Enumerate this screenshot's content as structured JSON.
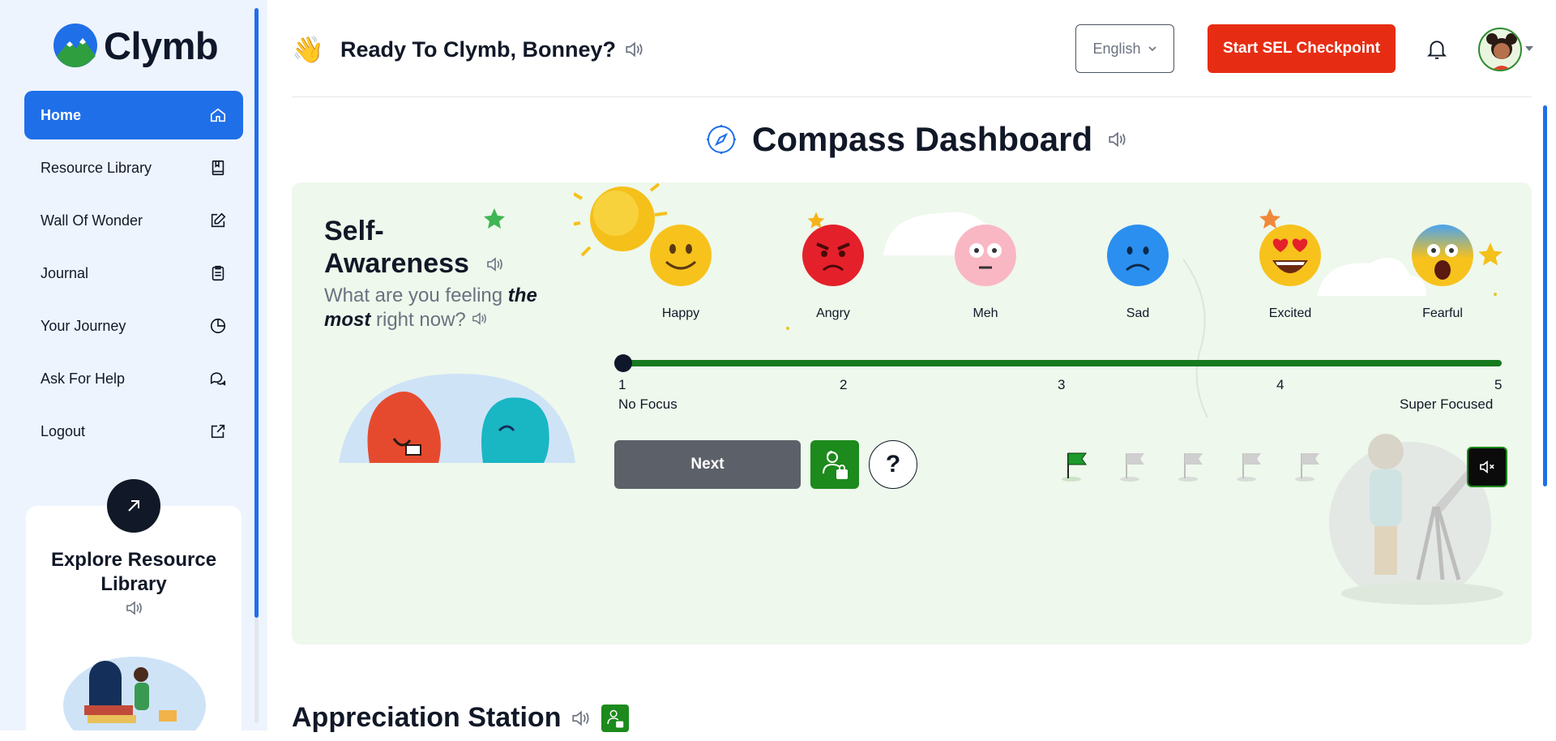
{
  "brand": {
    "name": "Clymb"
  },
  "sidebar": {
    "items": [
      {
        "label": "Home",
        "icon": "home-icon",
        "active": true
      },
      {
        "label": "Resource Library",
        "icon": "book-icon"
      },
      {
        "label": "Wall Of Wonder",
        "icon": "edit-icon"
      },
      {
        "label": "Journal",
        "icon": "clipboard-icon"
      },
      {
        "label": "Your Journey",
        "icon": "pie-chart-icon"
      },
      {
        "label": "Ask For Help",
        "icon": "chat-icon"
      },
      {
        "label": "Logout",
        "icon": "external-link-icon"
      }
    ],
    "explore": {
      "title": "Explore Resource Library"
    }
  },
  "header": {
    "greeting": "Ready To Clymb, Bonney?",
    "language": "English",
    "cta": "Start SEL Checkpoint"
  },
  "dashboard": {
    "title": "Compass Dashboard",
    "section": "Self-Awareness",
    "question_prefix": "What are you feeling ",
    "question_emph": "the most",
    "question_suffix": " right now?",
    "emotions": [
      "Happy",
      "Angry",
      "Meh",
      "Sad",
      "Excited",
      "Fearful"
    ],
    "scale": {
      "ticks": [
        "1",
        "2",
        "3",
        "4",
        "5"
      ],
      "min_label": "No Focus",
      "max_label": "Super Focused",
      "value": 1
    },
    "next_label": "Next",
    "help_label": "?",
    "progress_flags": {
      "total": 5,
      "completed": 1
    }
  },
  "next_section": {
    "title": "Appreciation Station"
  },
  "colors": {
    "primary": "#1f6fe8",
    "cta": "#e62d13",
    "green": "#1c8a1c",
    "card_bg": "#eef8ec"
  }
}
